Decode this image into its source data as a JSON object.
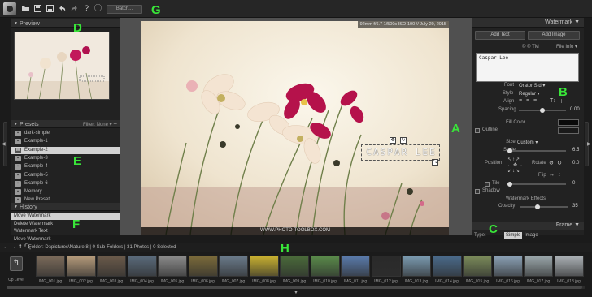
{
  "toolbar": {
    "icons": [
      "folder-icon",
      "save-icon",
      "save-as-icon",
      "undo-icon",
      "redo-icon",
      "help-icon",
      "info-icon"
    ],
    "help_glyph": "?",
    "info_glyph": "ⓘ",
    "batch_label": "Batch..."
  },
  "annotations": {
    "a": "A",
    "b": "B",
    "c": "C",
    "d": "D",
    "e": "E",
    "f": "F",
    "g": "G",
    "h": "H"
  },
  "left_panel": {
    "preview_title": "Preview",
    "presets_title": "Presets",
    "presets_filter": "Filter: None",
    "presets_add": "+",
    "presets": [
      {
        "label": "dark-simple",
        "icon": "▪"
      },
      {
        "label": "Example-1",
        "icon": "▪"
      },
      {
        "label": "Example-2",
        "icon": "W"
      },
      {
        "label": "Example-3",
        "icon": "▪"
      },
      {
        "label": "Example-4",
        "icon": "▪"
      },
      {
        "label": "Example-5",
        "icon": "▪"
      },
      {
        "label": "Example-6",
        "icon": "▪"
      },
      {
        "label": "Memory",
        "icon": "▪"
      },
      {
        "label": "New Preset",
        "icon": "▪"
      }
    ],
    "selected_preset": "Example-2",
    "history_title": "History",
    "history": [
      "Move Watermark",
      "Delete Watermark",
      "Watermark Text",
      "Move Watermark"
    ]
  },
  "photo": {
    "exif": "92mm f/6.7 1/500s ISO-100 // July 20, 2015",
    "watermark_text": "CASPAR LEE",
    "bottom_watermark": "WWW.PHOTO-TOOLBOX.COM"
  },
  "right_panel": {
    "title": "Watermark",
    "add_text": "Add Text",
    "add_image": "Add Image",
    "symbols": "©  ®  TM",
    "file_info": "File Info",
    "text_value": "Caspar  Lee",
    "font_label": "Font",
    "font_value": "Orator Std",
    "style_label": "Style",
    "style_value": "Regular",
    "align_label": "Align",
    "spacing_label": "Spacing",
    "spacing_value": "0.00",
    "fill_color_label": "Fill Color",
    "outline_label": "Outline",
    "size_label": "Size",
    "size_value": "Custom",
    "scale_label": "Scale",
    "scale_value": "6.5",
    "position_label": "Position",
    "rotate_label": "Rotate",
    "rotate_value": "0.0",
    "flip_label": "Flip",
    "tile_label": "Tile",
    "tile_value": "0",
    "shadow_label": "Shadow",
    "effects_label": "Watermark Effects",
    "opacity_label": "Opacity",
    "opacity_value": "35",
    "frame_title": "Frame",
    "type_label": "Type:",
    "type_simple": "Simple",
    "type_image": "Image",
    "colors": {
      "fill": "#0a0a0a",
      "outline": "#1a1a1a"
    }
  },
  "filmstrip": {
    "folder_info": "Folder: D:\\pictures\\Nature 8  |  0 Sub-Folders  |  31 Photos  |  0 Selected",
    "up_level": "Up Level",
    "thumbnails": [
      {
        "name": "IMG_001.jpg",
        "color": "#7a6a5a"
      },
      {
        "name": "IMG_002.jpg",
        "color": "#b49a7a"
      },
      {
        "name": "IMG_003.jpg",
        "color": "#6a5a4a"
      },
      {
        "name": "IMG_004.jpg",
        "color": "#5a6a7a"
      },
      {
        "name": "IMG_005.jpg",
        "color": "#8a8a8a"
      },
      {
        "name": "IMG_006.jpg",
        "color": "#7a6a3a"
      },
      {
        "name": "IMG_007.jpg",
        "color": "#6a7a8a"
      },
      {
        "name": "IMG_008.jpg",
        "color": "#c8b030"
      },
      {
        "name": "IMG_009.jpg",
        "color": "#4a6a3a"
      },
      {
        "name": "IMG_010.jpg",
        "color": "#5a8a4a"
      },
      {
        "name": "IMG_011.jpg",
        "color": "#5a7aaa"
      },
      {
        "name": "IMG_012.jpg",
        "color": "#2a2a2a"
      },
      {
        "name": "IMG_013.jpg",
        "color": "#7a9ab0"
      },
      {
        "name": "IMG_014.jpg",
        "color": "#4a6a8a"
      },
      {
        "name": "IMG_015.jpg",
        "color": "#7a8a5a"
      },
      {
        "name": "IMG_016.jpg",
        "color": "#8aa0b4"
      },
      {
        "name": "IMG_017.jpg",
        "color": "#9aa6aa"
      },
      {
        "name": "IMG_018.jpg",
        "color": "#aab0b4"
      }
    ]
  }
}
